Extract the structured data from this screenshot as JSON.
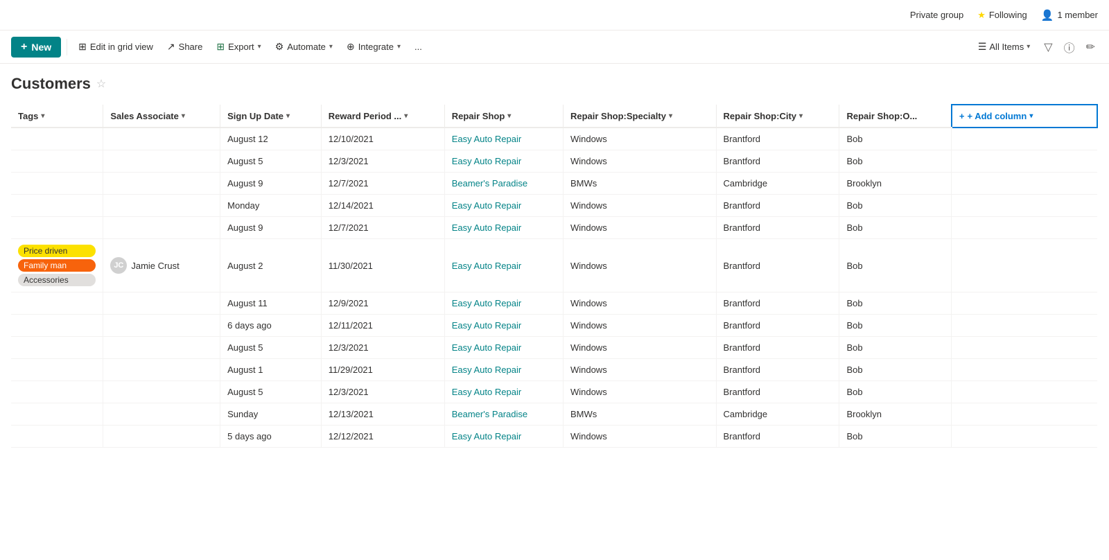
{
  "topbar": {
    "private_group": "Private group",
    "following": "Following",
    "member_count": "1 member"
  },
  "toolbar": {
    "new_label": "New",
    "edit_grid_label": "Edit in grid view",
    "share_label": "Share",
    "export_label": "Export",
    "automate_label": "Automate",
    "integrate_label": "Integrate",
    "more_label": "...",
    "view_name": "All Items"
  },
  "page": {
    "title": "Customers"
  },
  "table": {
    "columns": [
      {
        "key": "tags",
        "label": "Tags",
        "has_chevron": true
      },
      {
        "key": "sales_associate",
        "label": "Sales Associate",
        "has_chevron": true
      },
      {
        "key": "sign_up_date",
        "label": "Sign Up Date",
        "has_chevron": true
      },
      {
        "key": "reward_period",
        "label": "Reward Period ...",
        "has_chevron": true
      },
      {
        "key": "repair_shop",
        "label": "Repair Shop",
        "has_chevron": true
      },
      {
        "key": "repair_shop_specialty",
        "label": "Repair Shop:Specialty",
        "has_chevron": true
      },
      {
        "key": "repair_shop_city",
        "label": "Repair Shop:City",
        "has_chevron": true
      },
      {
        "key": "repair_shop_o",
        "label": "Repair Shop:O...",
        "has_chevron": false
      }
    ],
    "rows": [
      {
        "tags": [],
        "sales_associate": null,
        "sign_up_date": "August 12",
        "reward_period": "12/10/2021",
        "repair_shop": "Easy Auto Repair",
        "repair_shop_specialty": "Windows",
        "repair_shop_city": "Brantford",
        "repair_shop_o": "Bob"
      },
      {
        "tags": [],
        "sales_associate": null,
        "sign_up_date": "August 5",
        "reward_period": "12/3/2021",
        "repair_shop": "Easy Auto Repair",
        "repair_shop_specialty": "Windows",
        "repair_shop_city": "Brantford",
        "repair_shop_o": "Bob"
      },
      {
        "tags": [],
        "sales_associate": null,
        "sign_up_date": "August 9",
        "reward_period": "12/7/2021",
        "repair_shop": "Beamer's Paradise",
        "repair_shop_specialty": "BMWs",
        "repair_shop_city": "Cambridge",
        "repair_shop_o": "Brooklyn"
      },
      {
        "tags": [],
        "sales_associate": null,
        "sign_up_date": "Monday",
        "reward_period": "12/14/2021",
        "repair_shop": "Easy Auto Repair",
        "repair_shop_specialty": "Windows",
        "repair_shop_city": "Brantford",
        "repair_shop_o": "Bob"
      },
      {
        "tags": [],
        "sales_associate": null,
        "sign_up_date": "August 9",
        "reward_period": "12/7/2021",
        "repair_shop": "Easy Auto Repair",
        "repair_shop_specialty": "Windows",
        "repair_shop_city": "Brantford",
        "repair_shop_o": "Bob"
      },
      {
        "tags": [
          "Price driven",
          "Family man",
          "Accessories"
        ],
        "sales_associate": {
          "name": "Jamie Crust",
          "initials": "JC"
        },
        "sign_up_date": "August 2",
        "reward_period": "11/30/2021",
        "repair_shop": "Easy Auto Repair",
        "repair_shop_specialty": "Windows",
        "repair_shop_city": "Brantford",
        "repair_shop_o": "Bob"
      },
      {
        "tags": [],
        "sales_associate": null,
        "sign_up_date": "August 11",
        "reward_period": "12/9/2021",
        "repair_shop": "Easy Auto Repair",
        "repair_shop_specialty": "Windows",
        "repair_shop_city": "Brantford",
        "repair_shop_o": "Bob"
      },
      {
        "tags": [],
        "sales_associate": null,
        "sign_up_date": "6 days ago",
        "reward_period": "12/11/2021",
        "repair_shop": "Easy Auto Repair",
        "repair_shop_specialty": "Windows",
        "repair_shop_city": "Brantford",
        "repair_shop_o": "Bob"
      },
      {
        "tags": [],
        "sales_associate": null,
        "sign_up_date": "August 5",
        "reward_period": "12/3/2021",
        "repair_shop": "Easy Auto Repair",
        "repair_shop_specialty": "Windows",
        "repair_shop_city": "Brantford",
        "repair_shop_o": "Bob"
      },
      {
        "tags": [],
        "sales_associate": null,
        "sign_up_date": "August 1",
        "reward_period": "11/29/2021",
        "repair_shop": "Easy Auto Repair",
        "repair_shop_specialty": "Windows",
        "repair_shop_city": "Brantford",
        "repair_shop_o": "Bob"
      },
      {
        "tags": [],
        "sales_associate": null,
        "sign_up_date": "August 5",
        "reward_period": "12/3/2021",
        "repair_shop": "Easy Auto Repair",
        "repair_shop_specialty": "Windows",
        "repair_shop_city": "Brantford",
        "repair_shop_o": "Bob"
      },
      {
        "tags": [],
        "sales_associate": null,
        "sign_up_date": "Sunday",
        "reward_period": "12/13/2021",
        "repair_shop": "Beamer's Paradise",
        "repair_shop_specialty": "BMWs",
        "repair_shop_city": "Cambridge",
        "repair_shop_o": "Brooklyn"
      },
      {
        "tags": [],
        "sales_associate": null,
        "sign_up_date": "5 days ago",
        "reward_period": "12/12/2021",
        "repair_shop": "Easy Auto Repair",
        "repair_shop_specialty": "Windows",
        "repair_shop_city": "Brantford",
        "repair_shop_o": "Bob"
      }
    ],
    "add_column_label": "+ Add column"
  },
  "tag_styles": {
    "Price driven": "yellow",
    "Family man": "orange",
    "Accessories": "gray"
  }
}
